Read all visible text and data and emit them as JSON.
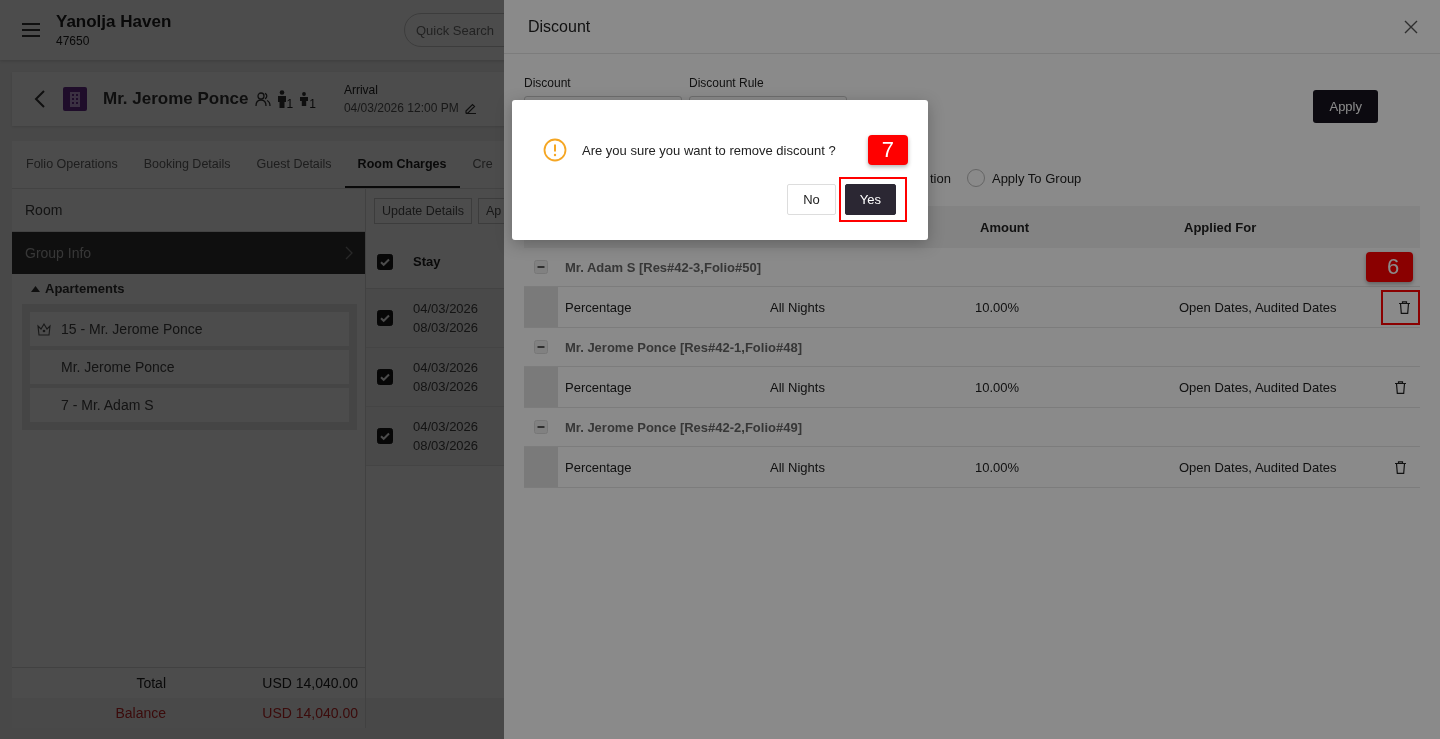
{
  "header": {
    "title": "Yanolja Haven",
    "subtitle": "47650",
    "search": {
      "placeholder": "Quick Search"
    }
  },
  "guest": {
    "name": "Mr. Jerome Ponce",
    "adults": "1",
    "children": "1",
    "arrival_label": "Arrival",
    "arrival": "04/03/2026 12:00 PM"
  },
  "tabs": [
    {
      "label": "Folio Operations",
      "selected": false
    },
    {
      "label": "Booking Details",
      "selected": false
    },
    {
      "label": "Guest Details",
      "selected": false
    },
    {
      "label": "Room Charges",
      "selected": true
    },
    {
      "label": "Cre",
      "selected": false
    }
  ],
  "room_panel": {
    "title": "Room",
    "items": [
      {
        "label": "Group Info",
        "selected": true
      }
    ],
    "tree": {
      "label": "Apartements",
      "expanded": true,
      "children": [
        {
          "label": "15 - Mr. Jerome Ponce",
          "kind": "master"
        },
        {
          "label": "Mr. Jerome Ponce",
          "kind": "guest"
        },
        {
          "label": "7 - Mr. Adam S",
          "kind": "guest"
        }
      ]
    },
    "totals": [
      {
        "label": "Total",
        "value": "USD 14,040.00",
        "kind": "normal"
      },
      {
        "label": "Balance",
        "value": "USD 14,040.00",
        "kind": "due"
      }
    ]
  },
  "charges": {
    "buttons": [
      "Update Details",
      "Ap"
    ],
    "header": {
      "label": "Stay",
      "checked": true
    },
    "rows": [
      {
        "checked": true,
        "from": "04/03/2026",
        "to": "08/03/2026"
      },
      {
        "checked": true,
        "from": "04/03/2026",
        "to": "08/03/2026"
      },
      {
        "checked": true,
        "from": "04/03/2026",
        "to": "08/03/2026"
      }
    ]
  },
  "drawer": {
    "title": "Discount",
    "fields": [
      {
        "label": "Discount"
      },
      {
        "label": "Discount Rule"
      }
    ],
    "apply_button": "Apply",
    "options": [
      {
        "label": "tion"
      },
      {
        "label": "Apply To Group",
        "selected": false
      }
    ],
    "columns": [
      "Amount",
      "Applied For"
    ],
    "groups": [
      {
        "title": "Mr. Adam S [Res#42-3,Folio#50]",
        "expanded": true,
        "rows": [
          {
            "type": "Percentage",
            "nights": "All Nights",
            "amount": "10.00%",
            "applied_for": "Open Dates, Audited Dates",
            "annotation": "6"
          }
        ]
      },
      {
        "title": "Mr. Jerome Ponce [Res#42-1,Folio#48]",
        "expanded": true,
        "rows": [
          {
            "type": "Percentage",
            "nights": "All Nights",
            "amount": "10.00%",
            "applied_for": "Open Dates, Audited Dates"
          }
        ]
      },
      {
        "title": "Mr. Jerome Ponce [Res#42-2,Folio#49]",
        "expanded": true,
        "rows": [
          {
            "type": "Percentage",
            "nights": "All Nights",
            "amount": "10.00%",
            "applied_for": "Open Dates, Audited Dates"
          }
        ]
      }
    ]
  },
  "dialog": {
    "message": "Are you sure you want to remove discount ?",
    "buttons": [
      "No",
      "Yes"
    ],
    "annotation": "7"
  }
}
